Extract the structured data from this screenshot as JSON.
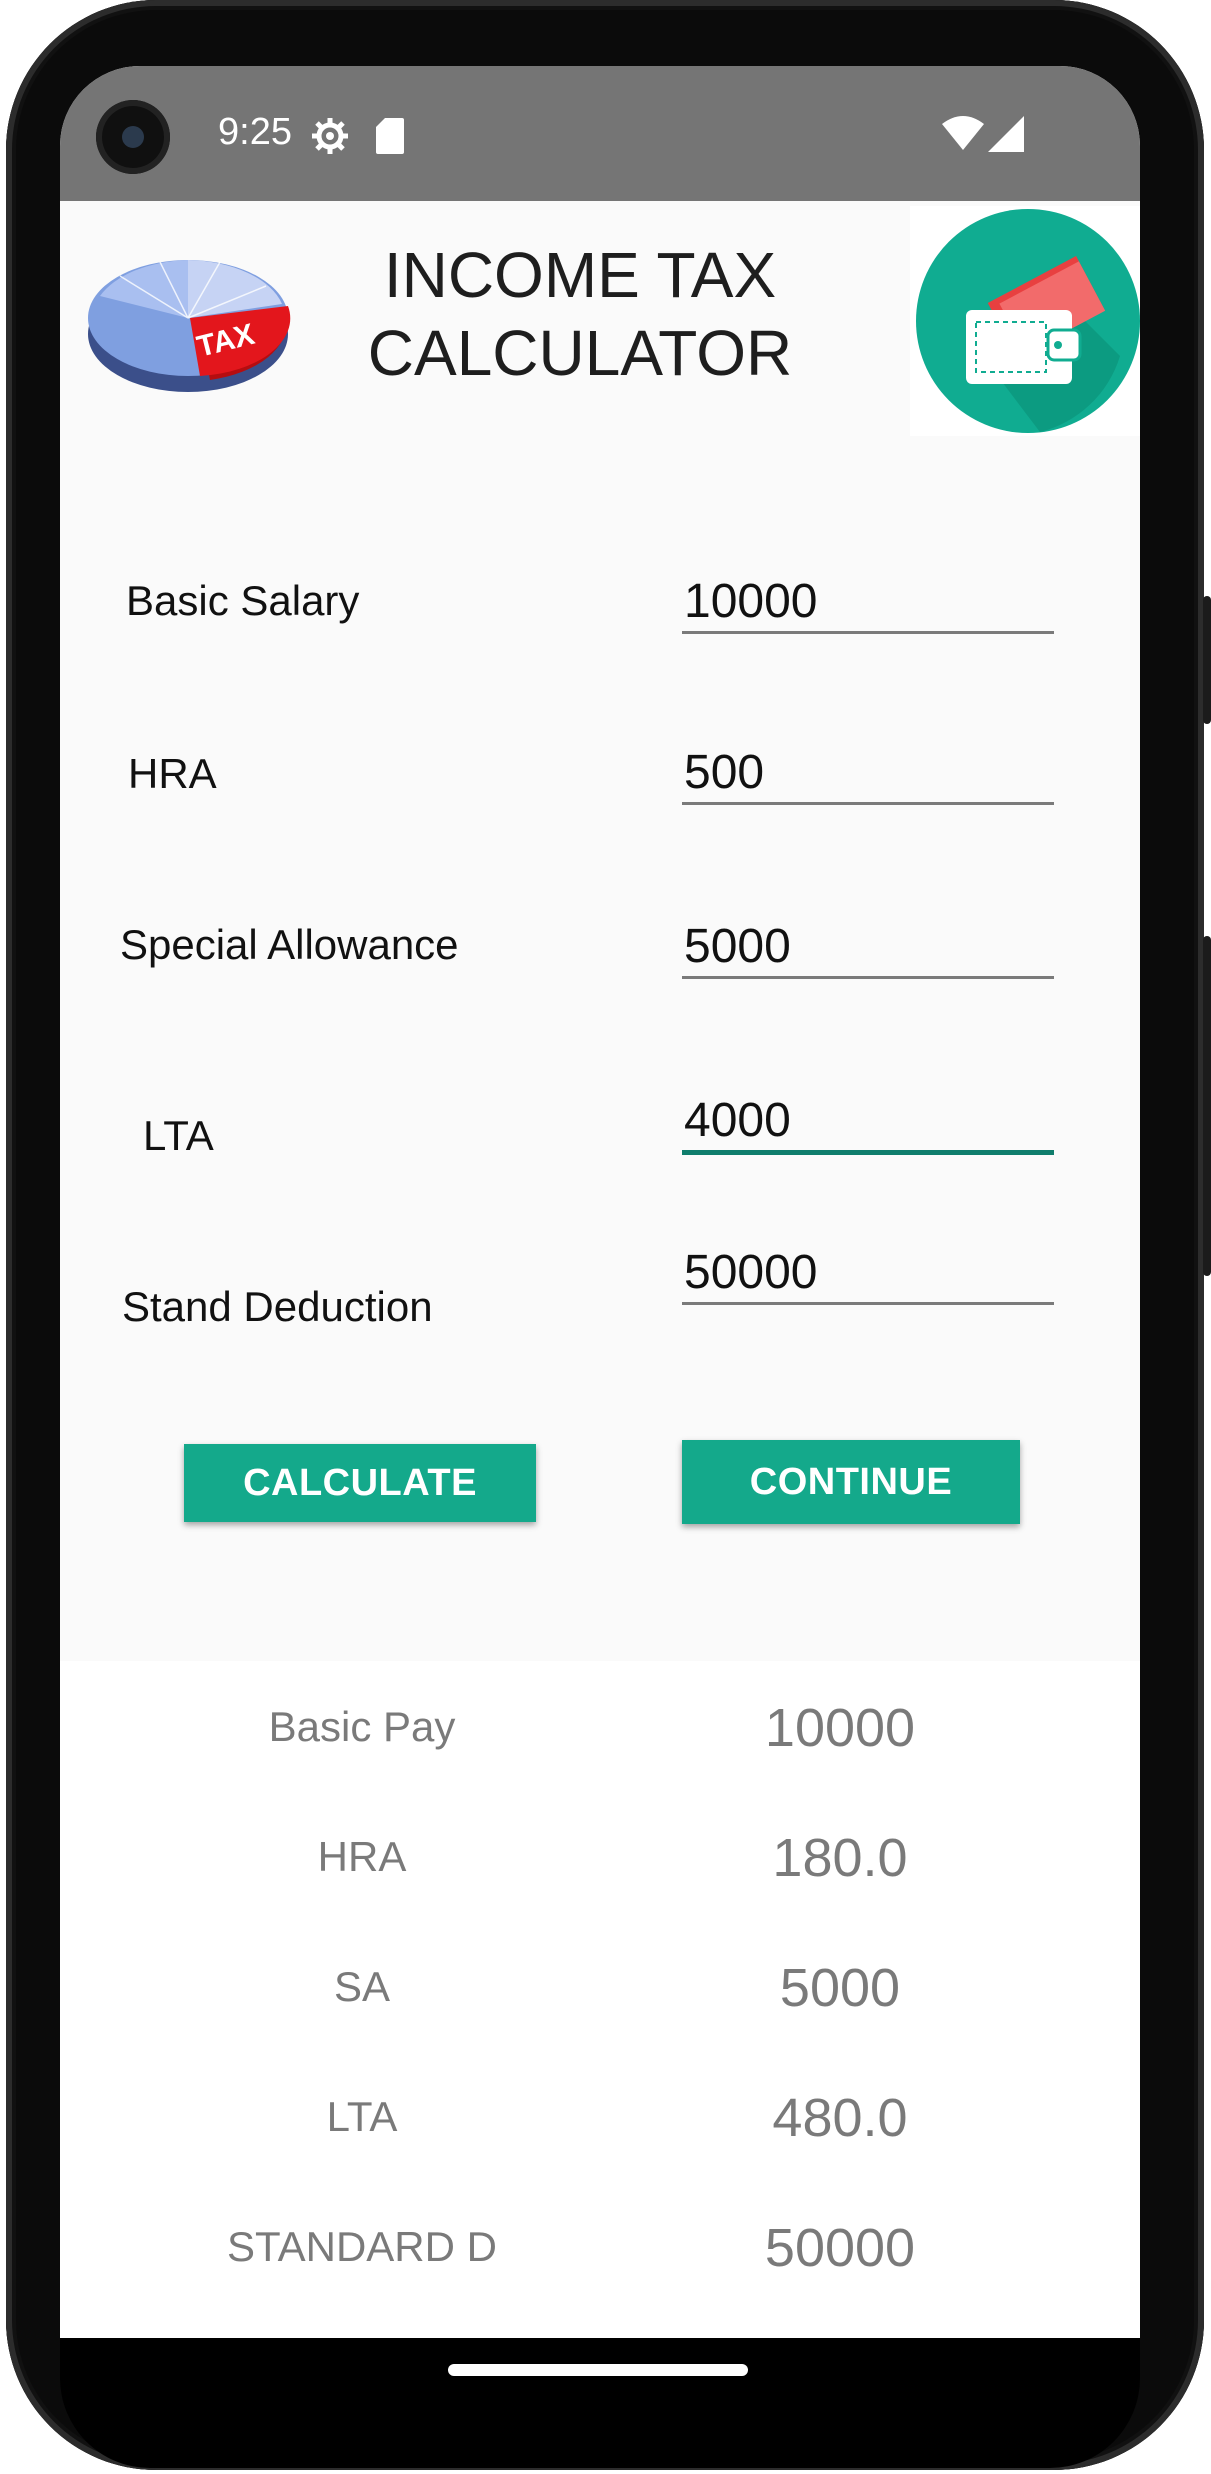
{
  "status_bar": {
    "time": "9:25",
    "icons": [
      "settings-icon",
      "sd-card-icon",
      "wifi-icon",
      "signal-icon"
    ]
  },
  "header": {
    "title": "INCOME TAX\nCALCULATOR",
    "left_logo": "tax-pie-logo",
    "left_logo_text": "TAX",
    "right_logo": "wallet-logo"
  },
  "form": {
    "fields": [
      {
        "label": "Basic Salary",
        "value": "10000"
      },
      {
        "label": "HRA",
        "value": "500"
      },
      {
        "label": "Special Allowance",
        "value": "5000"
      },
      {
        "label": "LTA",
        "value": "4000"
      },
      {
        "label": "Stand Deduction",
        "value": "50000"
      }
    ],
    "calculate_label": "CALCULATE",
    "continue_label": "CONTINUE"
  },
  "results": {
    "rows": [
      {
        "label": "Basic Pay",
        "value": "10000"
      },
      {
        "label": "HRA",
        "value": "180.0"
      },
      {
        "label": "SA",
        "value": "5000"
      },
      {
        "label": "LTA",
        "value": "480.0"
      },
      {
        "label": "STANDARD D",
        "value": "50000"
      }
    ]
  },
  "colors": {
    "accent": "#14a98b",
    "active_underline": "#0f7d6c",
    "status_bar": "#757575",
    "wallet_circle": "#10ac91"
  }
}
